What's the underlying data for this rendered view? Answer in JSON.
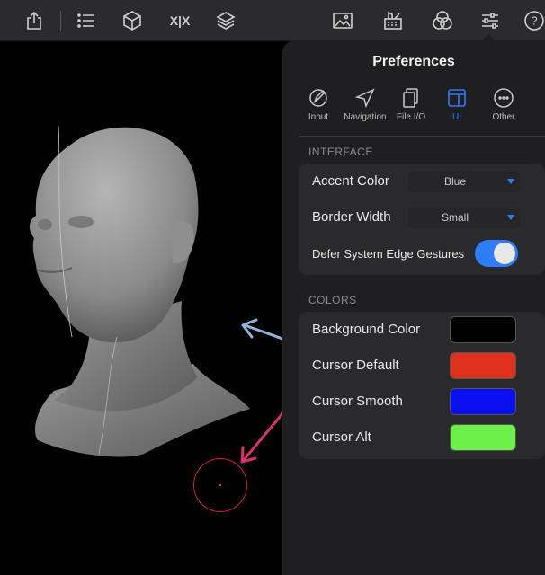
{
  "toolbar": {
    "left_icons": [
      "share-icon",
      "list-icon",
      "cube-icon",
      "symmetry-icon",
      "layers-icon"
    ],
    "right_icons": [
      "image-icon",
      "paint-icon",
      "materials-icon",
      "sliders-icon",
      "help-icon"
    ],
    "symmetry_text": "X|X",
    "help_text": "?"
  },
  "preferences": {
    "title": "Preferences",
    "tabs": [
      {
        "label": "Input",
        "icon": "pencil-icon",
        "active": false
      },
      {
        "label": "Navigation",
        "icon": "navigation-icon",
        "active": false
      },
      {
        "label": "File I/O",
        "icon": "files-icon",
        "active": false
      },
      {
        "label": "UI",
        "icon": "ui-layout-icon",
        "active": true
      },
      {
        "label": "Other",
        "icon": "more-icon",
        "active": false
      }
    ],
    "interface": {
      "header": "INTERFACE",
      "accent_color": {
        "label": "Accent Color",
        "value": "Blue"
      },
      "border_width": {
        "label": "Border Width",
        "value": "Small"
      },
      "defer_gestures": {
        "label": "Defer System Edge Gestures",
        "on": true
      }
    },
    "colors": {
      "header": "COLORS",
      "items": [
        {
          "label": "Background Color",
          "color": "#000000"
        },
        {
          "label": "Cursor Default",
          "color": "#e0301e"
        },
        {
          "label": "Cursor Smooth",
          "color": "#0a10f0"
        },
        {
          "label": "Cursor Alt",
          "color": "#6ef04a"
        }
      ]
    }
  },
  "theme": {
    "accent": "#2e7cf6",
    "panel": "#1f1f21",
    "toolbar": "#2b2b2d",
    "annotation_blue": "#8fb3dc",
    "annotation_pink": "#d6336c"
  }
}
